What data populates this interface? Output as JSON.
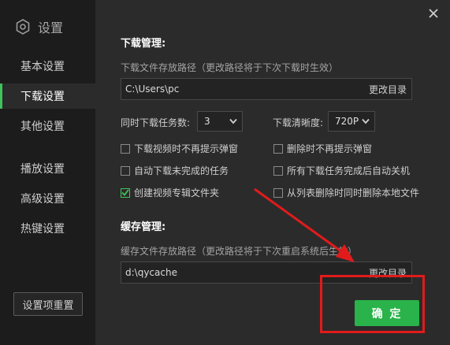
{
  "app": {
    "title": "设置"
  },
  "sidebar": {
    "items": [
      {
        "label": "基本设置"
      },
      {
        "label": "下载设置"
      },
      {
        "label": "其他设置"
      },
      {
        "label": "播放设置"
      },
      {
        "label": "高级设置"
      },
      {
        "label": "热键设置"
      }
    ],
    "active_index": 1,
    "reset_label": "设置项重置"
  },
  "download": {
    "title": "下载管理:",
    "path_hint": "下载文件存放路径（更改路径将于下次下载时生效）",
    "path_value": "C:\\Users\\pc",
    "change_dir_label": "更改目录",
    "concurrent_label": "同时下载任务数:",
    "concurrent_value": "3",
    "quality_label": "下载清晰度:",
    "quality_value": "720P",
    "options": [
      {
        "label": "下载视频时不再提示弹窗",
        "checked": false
      },
      {
        "label": "删除时不再提示弹窗",
        "checked": false
      },
      {
        "label": "自动下载未完成的任务",
        "checked": false
      },
      {
        "label": "所有下载任务完成后自动关机",
        "checked": false
      },
      {
        "label": "创建视频专辑文件夹",
        "checked": true
      },
      {
        "label": "从列表删除时同时删除本地文件",
        "checked": false
      }
    ]
  },
  "cache": {
    "title": "缓存管理:",
    "path_hint": "缓存文件存放路径（更改路径将于下次重启系统后生效）",
    "path_value": "d:\\qycache",
    "change_dir_label": "更改目录"
  },
  "footer": {
    "ok_label": "确 定"
  },
  "colors": {
    "accent": "#29b34a",
    "annotation": "#e11b1b"
  }
}
